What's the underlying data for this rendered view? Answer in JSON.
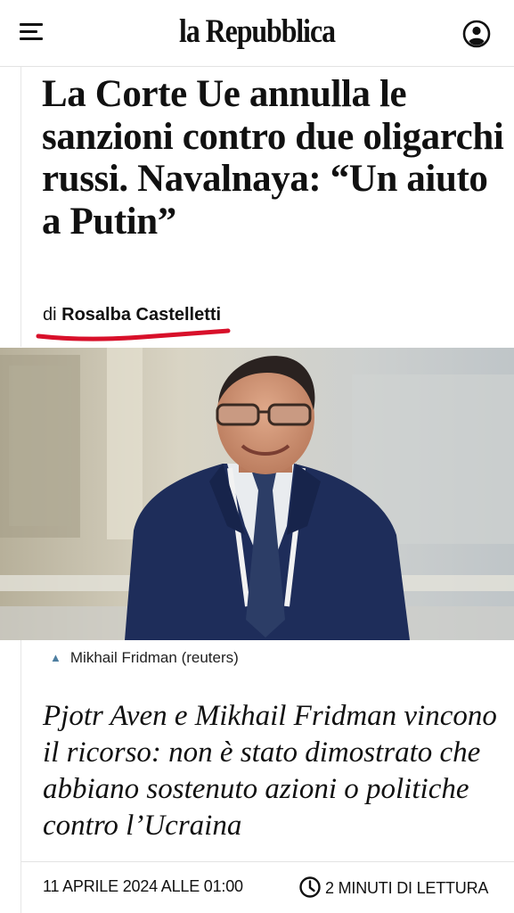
{
  "header": {
    "logo": "la Repubblica",
    "menu_icon": "hamburger-menu-icon",
    "account_icon": "user-account-icon"
  },
  "article": {
    "headline": "La Corte Ue annulla le sanzioni contro due oligarchi russi. Navalnaya: “Un aiuto a Putin”",
    "byline_prefix": "di",
    "author": "Rosalba Castelletti",
    "photo_caption": "Mikhail Fridman (reuters)",
    "summary": "Pjotr Aven e Mikhail Fridman vincono il ricorso: non è stato dimostrato che abbiano sostenuto azioni o politiche contro l’Ucraina",
    "date": "11 APRILE 2024 ALLE 01:00",
    "reading_time": "2 MINUTI DI LETTURA"
  },
  "colors": {
    "author_underline": "#d8102a",
    "caption_triangle": "#4d7ea0",
    "text": "#111111"
  }
}
